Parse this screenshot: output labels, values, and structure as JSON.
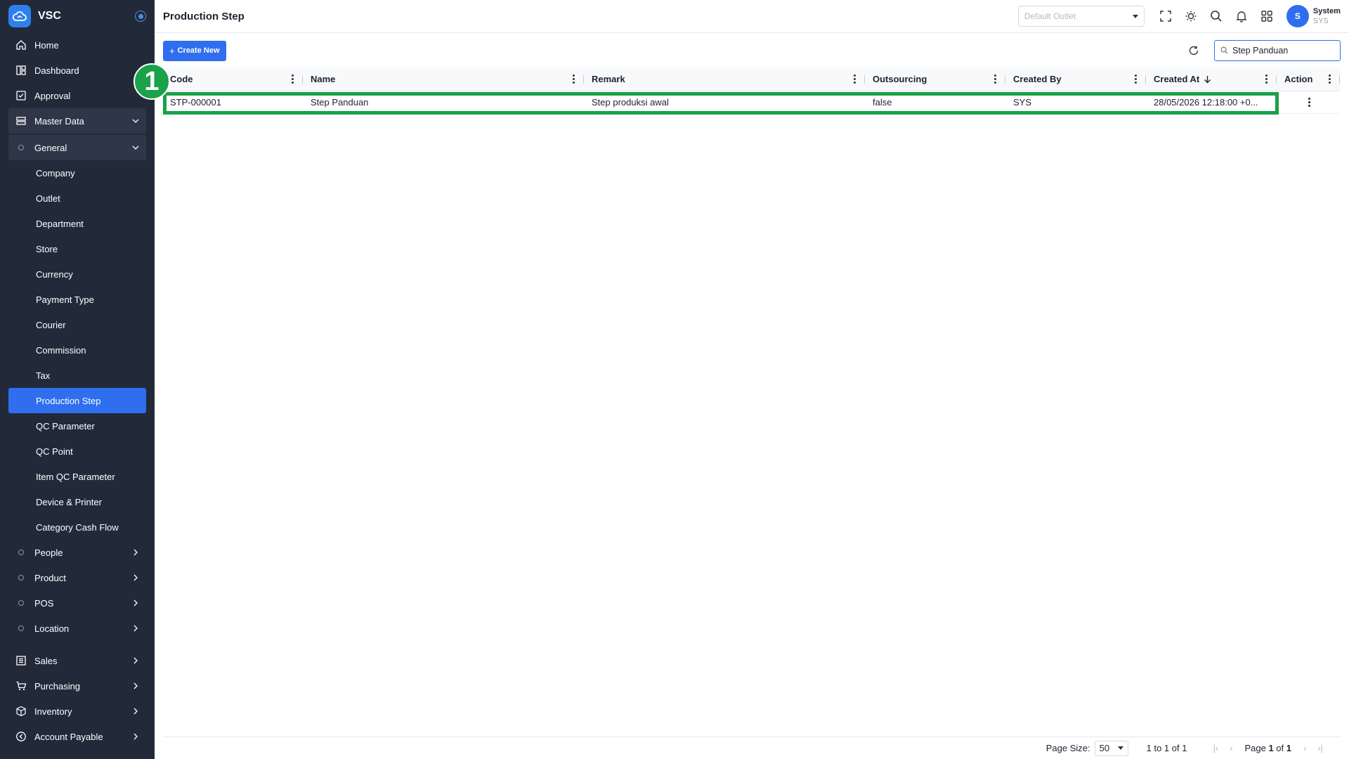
{
  "brand": {
    "name": "VSC"
  },
  "sidebar": {
    "top_items": [
      {
        "label": "Home",
        "icon": "home-icon"
      },
      {
        "label": "Dashboard",
        "icon": "dashboard-icon"
      },
      {
        "label": "Approval",
        "icon": "approval-icon"
      }
    ],
    "master_data": {
      "label": "Master Data"
    },
    "general": {
      "label": "General"
    },
    "general_items": [
      "Company",
      "Outlet",
      "Department",
      "Store",
      "Currency",
      "Payment Type",
      "Courier",
      "Commission",
      "Tax",
      "Production Step",
      "QC Parameter",
      "QC Point",
      "Item QC Parameter",
      "Device & Printer",
      "Category Cash Flow"
    ],
    "active_item": "Production Step",
    "sub_groups": [
      "People",
      "Product",
      "POS",
      "Location"
    ],
    "bottom_items": [
      {
        "label": "Sales",
        "icon": "sales-icon"
      },
      {
        "label": "Purchasing",
        "icon": "cart-icon"
      },
      {
        "label": "Inventory",
        "icon": "box-icon"
      },
      {
        "label": "Account Payable",
        "icon": "payable-icon"
      }
    ]
  },
  "topbar": {
    "title": "Production Step",
    "outlet_placeholder": "Default Outlet",
    "user_name": "System",
    "user_code": "SYS",
    "avatar_initial": "S"
  },
  "toolbar": {
    "create_label": "Create New",
    "search_value": "Step Panduan"
  },
  "table": {
    "columns": [
      "Code",
      "Name",
      "Remark",
      "Outsourcing",
      "Created By",
      "Created At",
      "Action"
    ],
    "sorted_column": "Created At",
    "rows": [
      {
        "code": "STP-000001",
        "name": "Step Panduan",
        "remark": "Step produksi awal",
        "outsourcing": "false",
        "created_by": "SYS",
        "created_at": "28/05/2026 12:18:00 +0..."
      }
    ]
  },
  "annotation": {
    "number": "1",
    "color": "#1aa14a"
  },
  "footer": {
    "page_size_label": "Page Size:",
    "page_size": "50",
    "range_text": "1 to 1 of 1",
    "page_word": "Page",
    "page_current": "1",
    "page_of": "of",
    "page_total": "1"
  },
  "colors": {
    "sidebar_bg": "#222a3a",
    "accent": "#2f6fef",
    "highlight": "#1aa14a"
  }
}
